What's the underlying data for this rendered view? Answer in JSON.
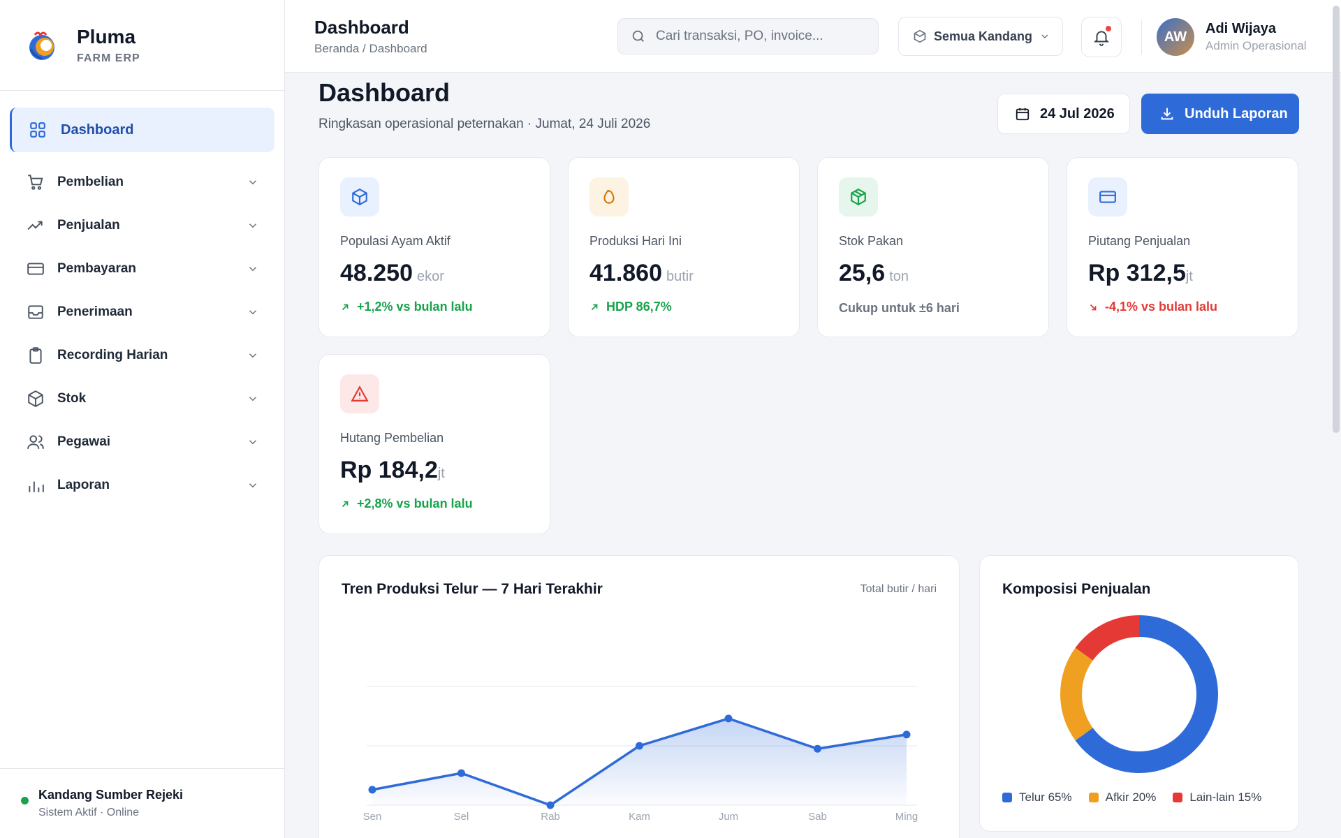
{
  "brand": {
    "name": "Pluma",
    "sub": "FARM ERP"
  },
  "sidebar": {
    "active": {
      "label": "Dashboard",
      "icon": "grid-icon"
    },
    "items": [
      {
        "label": "Pembelian",
        "icon": "cart-icon"
      },
      {
        "label": "Penjualan",
        "icon": "trend-up-icon"
      },
      {
        "label": "Pembayaran",
        "icon": "card-icon"
      },
      {
        "label": "Penerimaan",
        "icon": "inbox-icon"
      },
      {
        "label": "Recording Harian",
        "icon": "clipboard-icon"
      },
      {
        "label": "Stok",
        "icon": "box-icon"
      },
      {
        "label": "Pegawai",
        "icon": "users-icon"
      },
      {
        "label": "Laporan",
        "icon": "bar-chart-icon"
      }
    ],
    "footer": {
      "title": "Kandang Sumber Rejeki",
      "status": "Sistem Aktif · Online"
    }
  },
  "topbar": {
    "title": "Dashboard",
    "breadcrumb": "Beranda / Dashboard",
    "search_placeholder": "Cari transaksi, PO, invoice...",
    "kandang_label": "Semua Kandang",
    "user": {
      "initials": "AW",
      "name": "Adi Wijaya",
      "role": "Admin Operasional"
    }
  },
  "page": {
    "title": "Dashboard",
    "subtitle": "Ringkasan operasional peternakan · Jumat, 24 Juli 2026",
    "date_label": "24 Jul 2026",
    "download_label": "Unduh Laporan"
  },
  "stats": [
    {
      "label": "Populasi Ayam Aktif",
      "value": "48.250",
      "unit": "ekor",
      "trend": "+1,2% vs bulan lalu",
      "trend_dir": "up",
      "icon": "cube-icon",
      "color": "#2f6bd8",
      "bg": "#eaf1fe"
    },
    {
      "label": "Produksi Hari Ini",
      "value": "41.860",
      "unit": "butir",
      "trend": "HDP 86,7%",
      "trend_dir": "up",
      "icon": "egg-icon",
      "color": "#d97706",
      "bg": "#fdf3e2"
    },
    {
      "label": "Stok Pakan",
      "value": "25,6",
      "unit": "ton",
      "trend": "Cukup untuk ±6 hari",
      "trend_dir": "none",
      "icon": "package-icon",
      "color": "#16a34a",
      "bg": "#e6f6ec"
    },
    {
      "label": "Piutang Penjualan",
      "value": "Rp 312,5",
      "unit": "jt",
      "trend": "-4,1% vs bulan lalu",
      "trend_dir": "down",
      "icon": "credit-card-icon",
      "color": "#2f6bd8",
      "bg": "#eaf1fe"
    },
    {
      "label": "Hutang Pembelian",
      "value": "Rp 184,2",
      "unit": "jt",
      "trend": "+2,8% vs bulan lalu",
      "trend_dir": "up",
      "icon": "warning-icon",
      "color": "#e53935",
      "bg": "#fde8e8"
    }
  ],
  "trend_panel": {
    "title": "Tren Produksi Telur — 7 Hari Terakhir",
    "note": "Total butir / hari"
  },
  "composition_panel": {
    "title": "Komposisi Penjualan"
  },
  "chart_data": [
    {
      "type": "area",
      "title": "Tren Produksi Telur — 7 Hari Terakhir",
      "categories": [
        "Sen",
        "Sel",
        "Rab",
        "Kam",
        "Jum",
        "Sab",
        "Ming"
      ],
      "values": [
        0.26,
        0.54,
        0.0,
        1.0,
        1.46,
        0.95,
        1.19
      ],
      "value_note": "relative scale (no y-axis ticks printed); gridlines at 1.0 and 2.0",
      "ylim": [
        0,
        2.0
      ],
      "grid": true,
      "color": "#2f6bd8"
    },
    {
      "type": "pie",
      "title": "Komposisi Penjualan",
      "donut": true,
      "slices": [
        {
          "label": "Telur 65%",
          "value": 65,
          "color": "#2f6bd8"
        },
        {
          "label": "Afkir 20%",
          "value": 20,
          "color": "#f0a020"
        },
        {
          "label": "Lain-lain 15%",
          "value": 15,
          "color": "#e53935"
        }
      ],
      "legend": "bottom"
    }
  ]
}
